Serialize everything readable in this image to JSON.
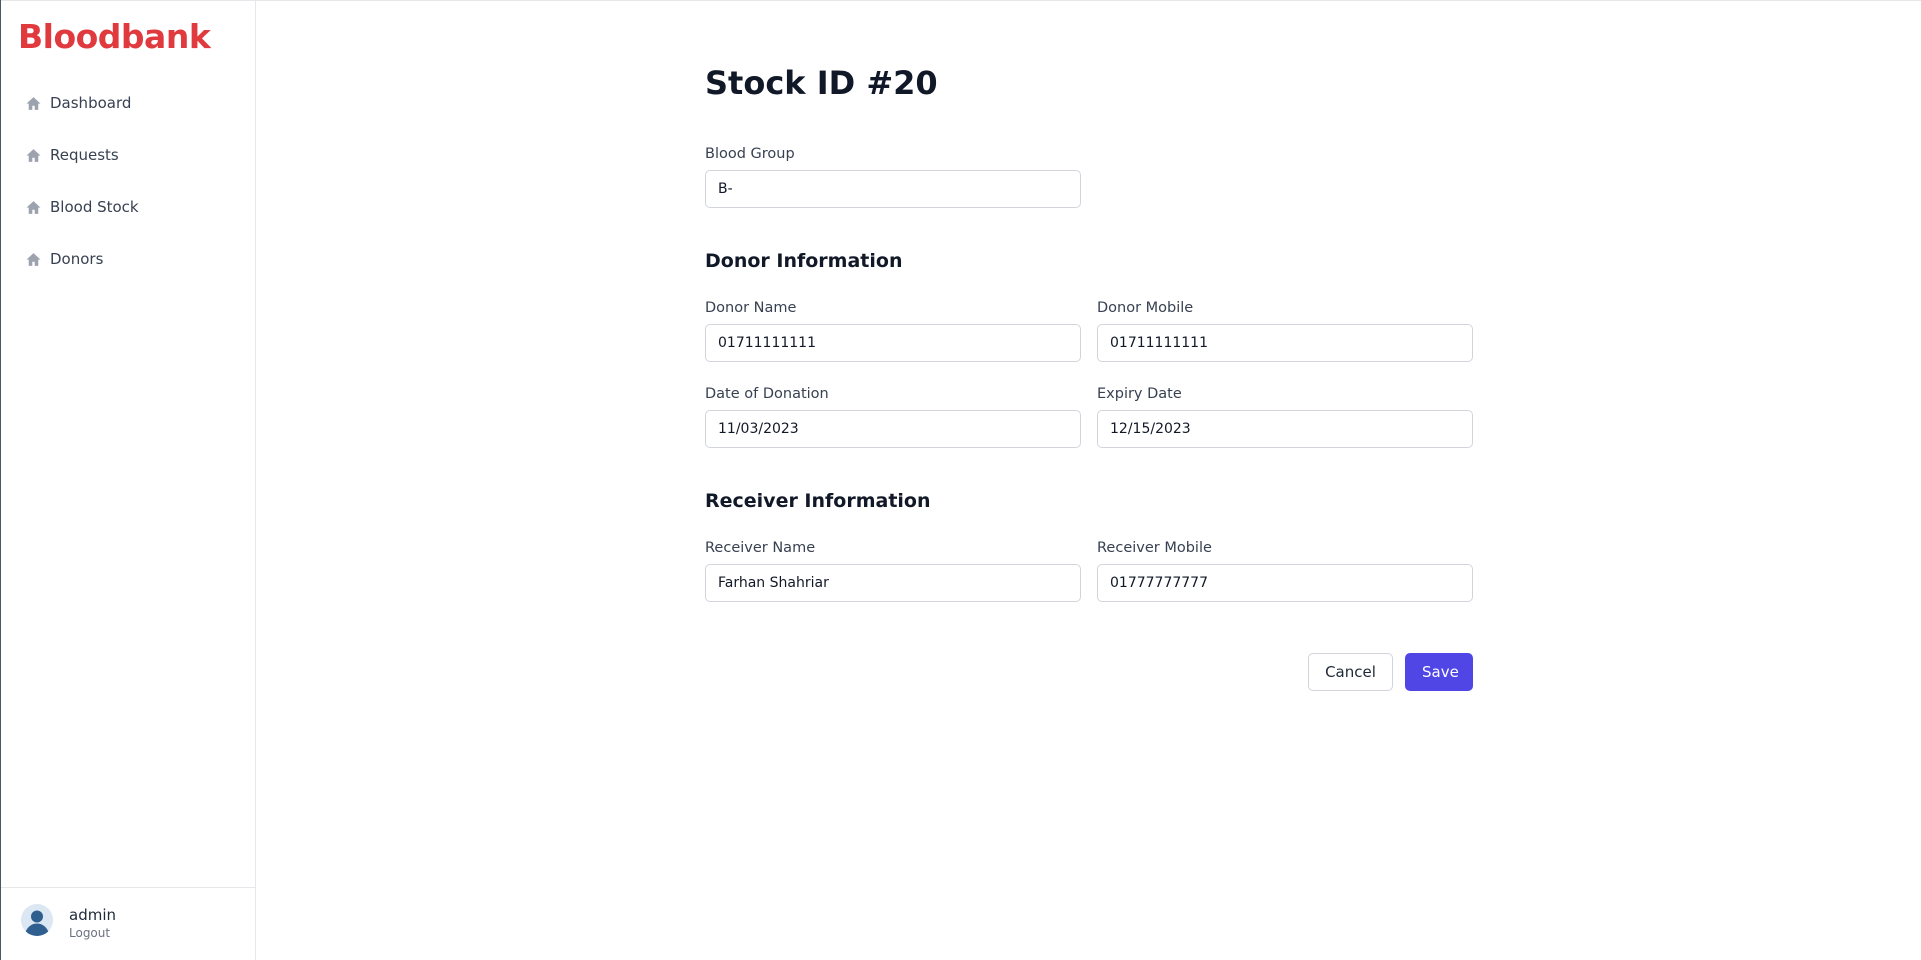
{
  "app": {
    "brand": "Bloodbank",
    "brand_color": "#e0393e",
    "accent_color": "#4f46e5"
  },
  "sidebar": {
    "items": [
      {
        "label": "Dashboard",
        "icon": "home-icon"
      },
      {
        "label": "Requests",
        "icon": "home-icon"
      },
      {
        "label": "Blood Stock",
        "icon": "home-icon"
      },
      {
        "label": "Donors",
        "icon": "home-icon"
      }
    ],
    "user": {
      "name": "admin",
      "logout_label": "Logout",
      "icon": "user-avatar-icon"
    }
  },
  "form": {
    "title": "Stock ID #20",
    "blood_group": {
      "label": "Blood Group",
      "value": "B-"
    },
    "donor_section_title": "Donor Information",
    "donor_name": {
      "label": "Donor Name",
      "value": "01711111111"
    },
    "donor_mobile": {
      "label": "Donor Mobile",
      "value": "01711111111"
    },
    "date_of_donation": {
      "label": "Date of Donation",
      "value": "11/03/2023"
    },
    "expiry_date": {
      "label": "Expiry Date",
      "value": "12/15/2023"
    },
    "receiver_section_title": "Receiver Information",
    "receiver_name": {
      "label": "Receiver Name",
      "value": "Farhan Shahriar"
    },
    "receiver_mobile": {
      "label": "Receiver Mobile",
      "value": "01777777777"
    },
    "cancel_label": "Cancel",
    "save_label": "Save"
  }
}
